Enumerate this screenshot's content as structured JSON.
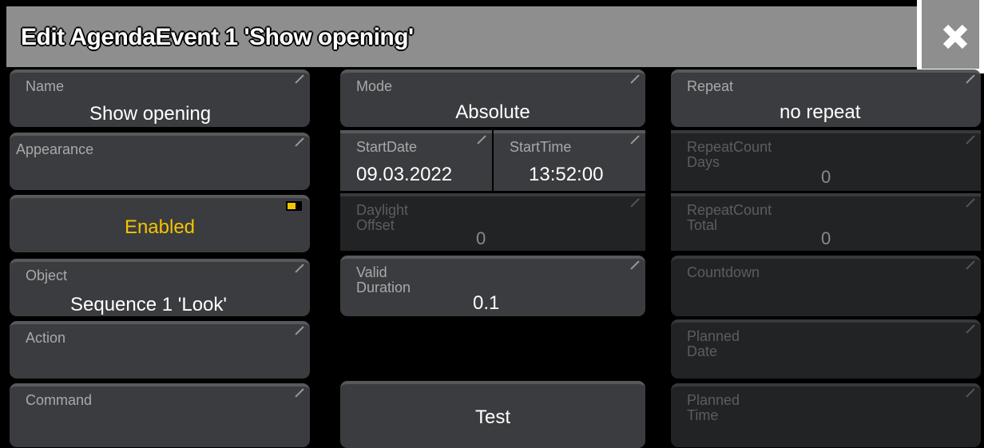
{
  "dialog": {
    "title": "Edit AgendaEvent 1 'Show opening'"
  },
  "left": {
    "name_label": "Name",
    "name_value": "Show opening",
    "appearance_label": "Appearance",
    "enabled_label": "Enabled",
    "object_label": "Object",
    "object_value": "Sequence 1 'Look'",
    "action_label": "Action",
    "command_label": "Command"
  },
  "middle": {
    "mode_label": "Mode",
    "mode_value": "Absolute",
    "startdate_label": "StartDate",
    "startdate_value": "09.03.2022",
    "starttime_label": "StartTime",
    "starttime_value": "13:52:00",
    "daylight_label_1": "Daylight",
    "daylight_label_2": "Offset",
    "daylight_value": "0",
    "valid_label_1": "Valid",
    "valid_label_2": "Duration",
    "valid_value": "0.1",
    "test_label": "Test"
  },
  "right": {
    "repeat_label": "Repeat",
    "repeat_value": "no repeat",
    "repeatcount_days_label_1": "RepeatCount",
    "repeatcount_days_label_2": "Days",
    "repeatcount_days_value": "0",
    "repeatcount_total_label_1": "RepeatCount",
    "repeatcount_total_label_2": "Total",
    "repeatcount_total_value": "0",
    "countdown_label": "Countdown",
    "planned_date_label_1": "Planned",
    "planned_date_label_2": "Date",
    "planned_time_label_1": "Planned",
    "planned_time_label_2": "Time"
  },
  "colors": {
    "enabled_text": "#f5c400",
    "titlebar": "#8e8e8e"
  },
  "icons": {
    "close": "close-x-icon",
    "edit_corner": "edit-corner-icon",
    "toggle": "toggle-indicator-icon"
  }
}
